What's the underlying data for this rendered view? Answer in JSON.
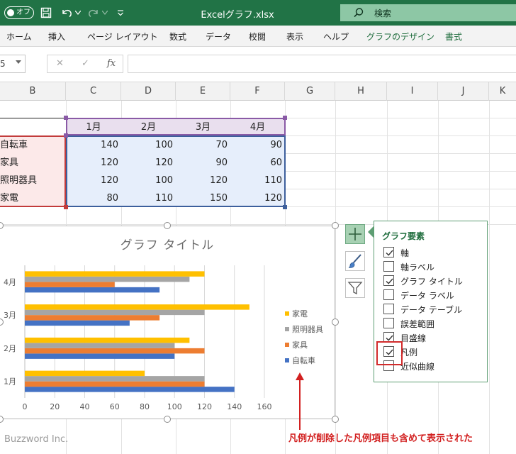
{
  "titlebar": {
    "autosave_label": "オフ",
    "doc_title": "Excelグラフ.xlsx",
    "search_label": "検索"
  },
  "ribbon": {
    "tabs": [
      "ホーム",
      "挿入",
      "ページ レイアウト",
      "数式",
      "データ",
      "校閲",
      "表示",
      "ヘルプ",
      "グラフのデザイン",
      "書式"
    ]
  },
  "formula_bar": {
    "name_box_value": "5",
    "cancel_glyph": "✕",
    "enter_glyph": "✓",
    "fx_glyph": "fx"
  },
  "sheet": {
    "columns": [
      "B",
      "C",
      "D",
      "E",
      "F",
      "G",
      "H",
      "I",
      "J",
      "K"
    ],
    "table": {
      "headers": [
        "1月",
        "2月",
        "3月",
        "4月"
      ],
      "rows": [
        {
          "label": "自転車",
          "values": [
            "140",
            "100",
            "70",
            "90"
          ]
        },
        {
          "label": "家具",
          "values": [
            "120",
            "120",
            "90",
            "60"
          ]
        },
        {
          "label": "照明器具",
          "values": [
            "120",
            "100",
            "120",
            "110"
          ]
        },
        {
          "label": "家電",
          "values": [
            "80",
            "110",
            "150",
            "120"
          ]
        }
      ]
    }
  },
  "chart_data": {
    "type": "bar",
    "orientation": "horizontal",
    "title": "グラフ タイトル",
    "categories": [
      "1月",
      "2月",
      "3月",
      "4月"
    ],
    "series": [
      {
        "name": "自転車",
        "color": "#4472c4",
        "values": [
          140,
          100,
          70,
          90
        ]
      },
      {
        "name": "家具",
        "color": "#ed7d31",
        "values": [
          120,
          120,
          90,
          60
        ]
      },
      {
        "name": "照明器具",
        "color": "#a5a5a5",
        "values": [
          120,
          100,
          120,
          110
        ]
      },
      {
        "name": "家電",
        "color": "#ffc000",
        "values": [
          80,
          110,
          150,
          120
        ]
      }
    ],
    "xlim": [
      0,
      160
    ],
    "x_ticks": [
      "0",
      "20",
      "40",
      "60",
      "80",
      "100",
      "120",
      "140",
      "160"
    ],
    "legend_position": "right",
    "grid": true
  },
  "chart_elements_panel": {
    "title": "グラフ要素",
    "items": [
      {
        "label": "軸",
        "checked": true
      },
      {
        "label": "軸ラベル",
        "checked": false
      },
      {
        "label": "グラフ タイトル",
        "checked": true
      },
      {
        "label": "データ ラベル",
        "checked": false
      },
      {
        "label": "データ テーブル",
        "checked": false
      },
      {
        "label": "誤差範囲",
        "checked": false
      },
      {
        "label": "目盛線",
        "checked": true
      },
      {
        "label": "凡例",
        "checked": true
      },
      {
        "label": "近似曲線",
        "checked": false
      }
    ]
  },
  "chart_buttons": [
    "plus-icon",
    "brush-icon",
    "filter-icon"
  ],
  "watermark": "Buzzword Inc.",
  "annotation": "凡例が削除した凡例項目も含めて表示された"
}
